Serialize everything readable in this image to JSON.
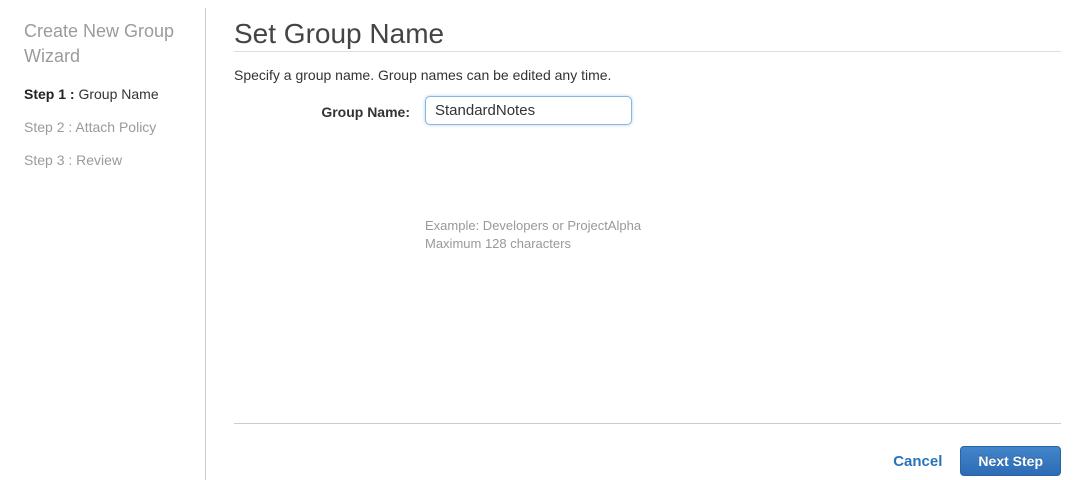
{
  "sidebar": {
    "title": "Create New Group Wizard",
    "steps": [
      {
        "prefix": "Step 1 :",
        "label": " Group Name"
      },
      {
        "prefix": "Step 2 :",
        "label": " Attach Policy"
      },
      {
        "prefix": "Step 3 :",
        "label": " Review"
      }
    ]
  },
  "main": {
    "title": "Set Group Name",
    "description": "Specify a group name. Group names can be edited any time.",
    "form": {
      "group_name_label": "Group Name:",
      "group_name_value": "StandardNotes",
      "hint_example": "Example: Developers or ProjectAlpha",
      "hint_max": "Maximum 128 characters"
    },
    "footer": {
      "cancel_label": "Cancel",
      "next_label": "Next Step"
    }
  },
  "colors": {
    "link_blue": "#2a73b8",
    "button_blue_top": "#4285c9",
    "button_blue_bottom": "#2d6cb5",
    "input_focus_border": "#8ab6e0",
    "divider_gray": "#cccccc",
    "muted_text": "#9b9b9b"
  }
}
